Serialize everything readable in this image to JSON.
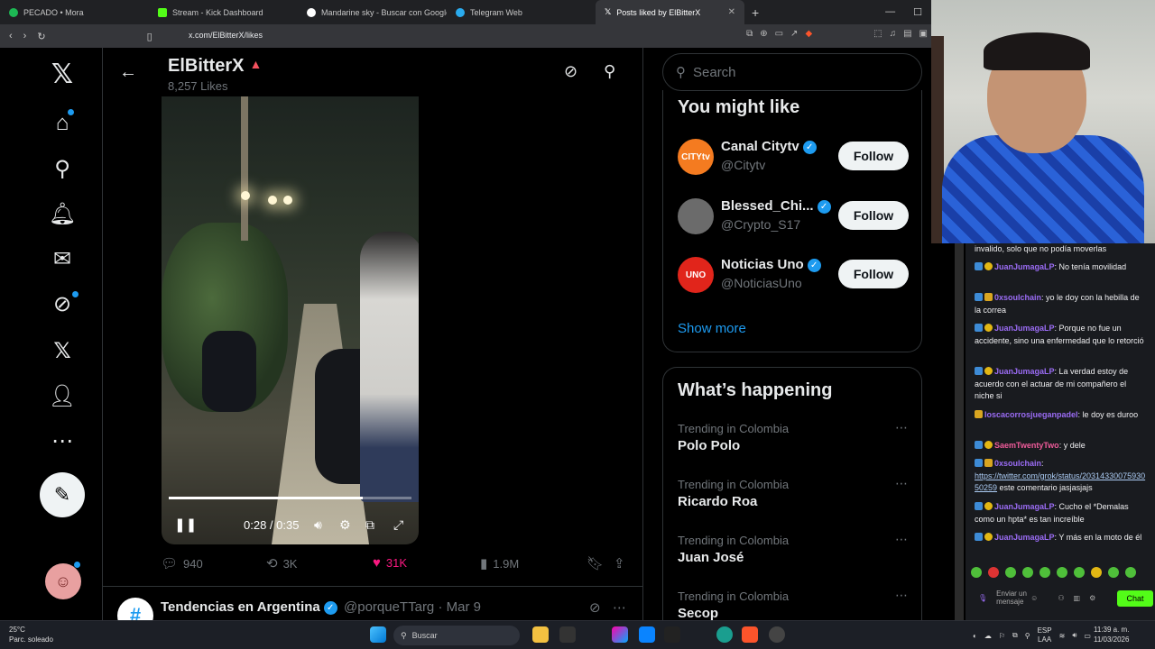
{
  "browser": {
    "tabs": [
      {
        "title": "PECADO • Mora",
        "color": "#1db954"
      },
      {
        "title": "Stream - Kick Dashboard",
        "color": "#53fc18"
      },
      {
        "title": "Mandarine sky - Buscar con Google",
        "color": "#ffffff"
      },
      {
        "title": "Telegram Web",
        "color": "#2aabee"
      },
      {
        "title": "Posts liked by ElBitterX",
        "color": "#ffffff"
      }
    ],
    "url": "x.com/ElBitterX/likes"
  },
  "header": {
    "title": "ElBitterX",
    "subtitle": "8,257 Likes"
  },
  "video": {
    "time": "0:28 / 0:35",
    "progress": 0.8
  },
  "tweet_actions": {
    "replies": "940",
    "reposts": "3K",
    "likes": "31K",
    "views": "1.9M"
  },
  "next_post": {
    "name": "Tendencias en Argentina",
    "handle": "@porqueTTarg · Mar 9",
    "avatar": "#"
  },
  "search": {
    "placeholder": "Search"
  },
  "who_to_follow": {
    "title": "You might like",
    "follow_label": "Follow",
    "show_more": "Show more",
    "accounts": [
      {
        "name": "Canal Citytv",
        "handle": "@Citytv",
        "avatar": "CITYtv",
        "color": "#f47b20"
      },
      {
        "name": "Blessed_Chi...",
        "handle": "@Crypto_S17",
        "avatar": "",
        "color": "#6b6b6b"
      },
      {
        "name": "Noticias Uno",
        "handle": "@NoticiasUno",
        "avatar": "UNO",
        "color": "#e1251b"
      }
    ]
  },
  "happening": {
    "title": "What’s happening",
    "trends": [
      {
        "context": "Trending in Colombia",
        "name": "Polo Polo"
      },
      {
        "context": "Trending in Colombia",
        "name": "Ricardo Roa"
      },
      {
        "context": "Trending in Colombia",
        "name": "Juan José"
      },
      {
        "context": "Trending in Colombia",
        "name": "Secop"
      }
    ]
  },
  "chat": {
    "messages": [
      {
        "user": "",
        "text": "invalido, solo que no podía moverlas"
      },
      {
        "user": "JuanJumagaLP",
        "text": "No tenía movilidad"
      },
      {
        "user": "0xsoulchain",
        "text": "yo le doy con la hebilla de la correa"
      },
      {
        "user": "JuanJumagaLP",
        "text": "Porque no fue un accidente, sino una enfermedad que lo retorció"
      },
      {
        "user": "JuanJumagaLP",
        "text": "La verdad estoy de acuerdo con el actuar de mi compañero el niche si"
      },
      {
        "user": "loscacorrosjueganpadel",
        "text": "le doy es duroo"
      },
      {
        "user": "SaemTwentyTwo",
        "text": "y dele"
      },
      {
        "user": "0xsoulchain",
        "text": ""
      },
      {
        "user": "JuanJumagaLP",
        "text": "Cucho el *Demalas como un hpta* es tan increíble"
      },
      {
        "user": "JuanJumagaLP",
        "text": "Y más en la moto de él"
      }
    ],
    "link": "https://twitter.com/grok/status/2031433007593050259",
    "link_suffix": "este comentario jasjasjajs",
    "input_placeholder": "Enviar un mensaje",
    "send_label": "Chat"
  },
  "taskbar": {
    "weather_temp": "25°C",
    "weather_desc": "Parc. soleado",
    "search_label": "Buscar",
    "lang": "ESP",
    "lang2": "LAA",
    "time": "11:39 a. m.",
    "date": "11/03/2026"
  }
}
